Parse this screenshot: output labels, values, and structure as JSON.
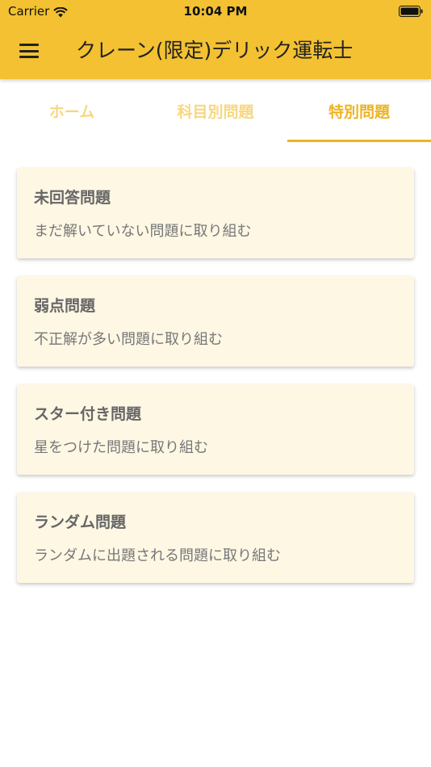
{
  "status_bar": {
    "carrier": "Carrier",
    "time": "10:04 PM",
    "icons": {
      "wifi": "wifi-icon",
      "battery": "battery-icon"
    }
  },
  "app_bar": {
    "title": "クレーン(限定)デリック運転士",
    "menu_icon": "hamburger-menu-icon",
    "color": "#F3C131"
  },
  "tabs": [
    {
      "label": "ホーム",
      "active": false
    },
    {
      "label": "科目別問題",
      "active": false
    },
    {
      "label": "特別問題",
      "active": true
    }
  ],
  "tab_colors": {
    "active": "#EDB423",
    "inactive": "#F7D77F"
  },
  "cards": [
    {
      "title": "未回答問題",
      "description": "まだ解いていない問題に取り組む"
    },
    {
      "title": "弱点問題",
      "description": "不正解が多い問題に取り組む"
    },
    {
      "title": "スター付き問題",
      "description": "星をつけた問題に取り組む"
    },
    {
      "title": "ランダム問題",
      "description": "ランダムに出題される問題に取り組む"
    }
  ],
  "card_color": "#FDF7E4"
}
